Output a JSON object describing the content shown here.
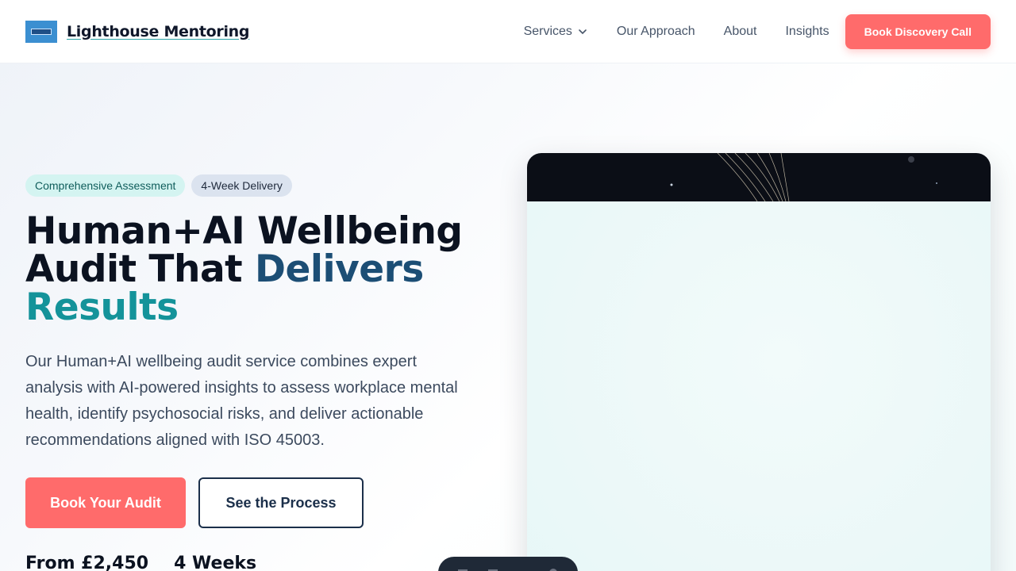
{
  "header": {
    "brand": "Lighthouse Mentoring",
    "nav": [
      {
        "label": "Services"
      },
      {
        "label": "Our Approach"
      },
      {
        "label": "About"
      },
      {
        "label": "Insights"
      }
    ],
    "cta": "Book Discovery Call"
  },
  "hero": {
    "badges": [
      "Comprehensive Assessment",
      "4-Week Delivery"
    ],
    "headline": {
      "part1": "Human+AI Wellbeing Audit That ",
      "part2": "Delivers",
      "part3": "Results"
    },
    "description": "Our Human+AI wellbeing audit service combines expert analysis with AI-powered insights to assess workplace mental health, identify psychosocial risks, and deliver actionable recommendations aligned with ISO 45003.",
    "primary_button": "Book Your Audit",
    "secondary_button": "See the Process",
    "stats": [
      "From £2,450",
      "4 Weeks"
    ]
  },
  "colors": {
    "accent_coral": "#ff6b6b",
    "navy": "#1c4e75",
    "teal": "#14939a"
  }
}
